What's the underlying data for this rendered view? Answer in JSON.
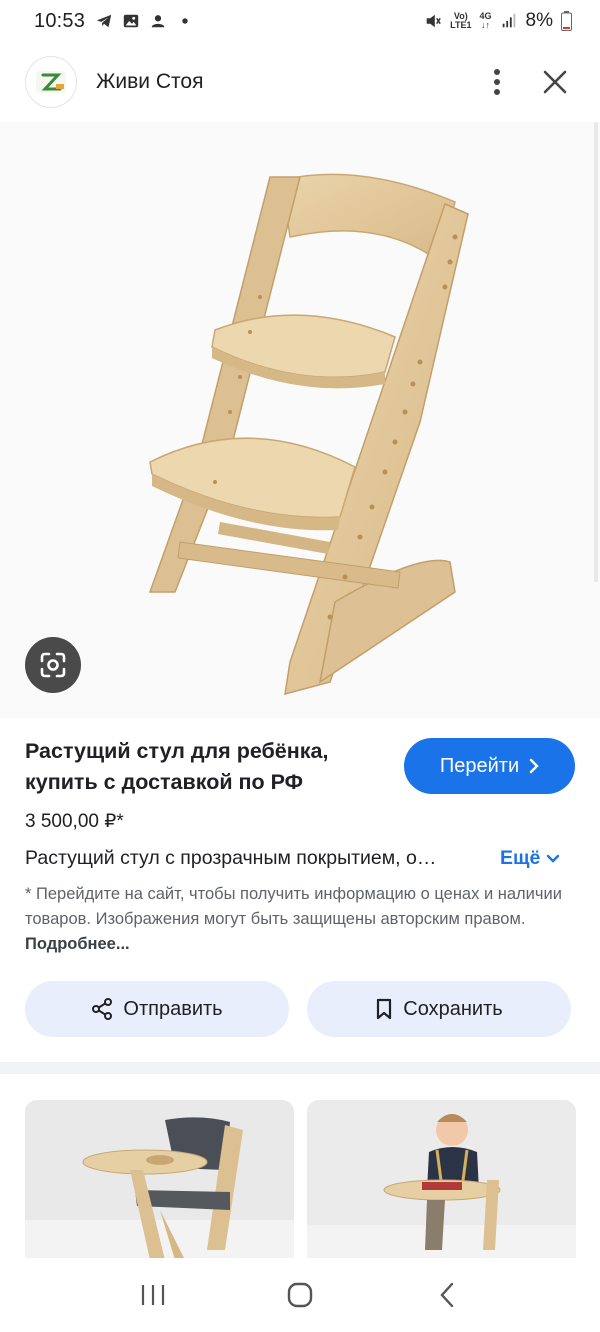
{
  "status_bar": {
    "time": "10:53",
    "battery": "8%",
    "network_top": "Vo)",
    "network_bottom": "LTE1",
    "gen": "4G"
  },
  "header": {
    "site_name": "Живи Стоя",
    "logo_letter": "Z"
  },
  "product": {
    "title": "Растущий стул для ребёнка, купить с доставкой по РФ",
    "price": "3 500,00 ₽*",
    "description": "Растущий стул с прозрачным покрытием, о…",
    "more_label": "Ещё",
    "visit_label": "Перейти",
    "disclaimer": "* Перейдите на сайт, чтобы получить информацию о ценах и наличии товаров. Изображения могут быть защищены авторским правом.",
    "disclaimer_link": "Подробнее..."
  },
  "actions": {
    "share_label": "Отправить",
    "save_label": "Сохранить"
  },
  "colors": {
    "accent": "#1a73e8",
    "pill_bg": "#e8eefc",
    "wood": "#e2c99b"
  }
}
